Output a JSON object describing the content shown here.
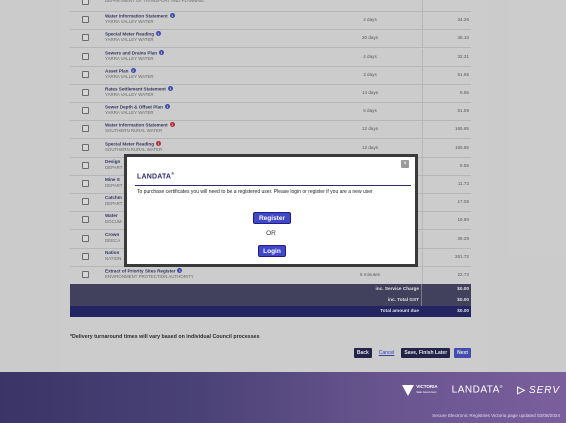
{
  "table": {
    "rows": [
      {
        "name": "",
        "authority": "Department of Transport and Planning",
        "time": "",
        "price": "",
        "info": "none",
        "partial": true
      },
      {
        "name": "Water Information Statement",
        "authority": "YARRA VALLEY WATER",
        "time": "4 days",
        "price": "34.26",
        "info": "blue"
      },
      {
        "name": "Special Meter Reading",
        "authority": "YARRA VALLEY WATER",
        "time": "20 days",
        "price": "46.10",
        "info": "blue"
      },
      {
        "name": "Sewers and Drains Plan",
        "authority": "YARRA VALLEY WATER",
        "time": "4 days",
        "price": "32.31",
        "info": "blue"
      },
      {
        "name": "Asset Plan",
        "authority": "YARRA VALLEY WATER",
        "time": "3 days",
        "price": "51.65",
        "info": "blue"
      },
      {
        "name": "Rates Settlement Statement",
        "authority": "YARRA VALLEY WATER",
        "time": "14 days",
        "price": "8.55",
        "info": "blue"
      },
      {
        "name": "Sewer Depth & Offset Plan",
        "authority": "YARRA VALLEY WATER",
        "time": "5 days",
        "price": "51.59",
        "info": "blue"
      },
      {
        "name": "Water Information Statement",
        "authority": "SOUTHERN RURAL WATER",
        "time": "12 days",
        "price": "165.65",
        "info": "red"
      },
      {
        "name": "Special Meter Reading",
        "authority": "SOUTHERN RURAL WATER",
        "time": "12 days",
        "price": "165.65",
        "info": "red"
      },
      {
        "name": "Design",
        "authority": "Depart",
        "time": "",
        "price": "8.55",
        "info": "none"
      },
      {
        "name": "Mine S",
        "authority": "Depart",
        "time": "",
        "price": "11.72",
        "info": "none"
      },
      {
        "name": "Catchm",
        "authority": "Depart",
        "time": "",
        "price": "17.05",
        "info": "none"
      },
      {
        "name": "Water",
        "authority": "Docum",
        "time": "",
        "price": "16.80",
        "info": "none"
      },
      {
        "name": "Crown",
        "authority": "DEECA",
        "time": "",
        "price": "39.29",
        "info": "none"
      },
      {
        "name": "Nation",
        "authority": "Nation",
        "time": "",
        "price": "261.72",
        "info": "none"
      },
      {
        "name": "Extract of Priority Sites Register",
        "authority": "Environment Protection Authority",
        "time": "5 minutes",
        "price": "22.72",
        "info": "blue"
      }
    ]
  },
  "summary": {
    "service_charge_label": "inc. Service Charge",
    "service_charge_value": "$0.00",
    "gst_label": "inc. Total GST",
    "gst_value": "$0.00",
    "total_label": "Total amount due",
    "total_value": "$0.00"
  },
  "delivery_note": "*Delivery turnaround times will vary based on individual Council processes",
  "actions": {
    "back": "Back",
    "cancel": "Cancel",
    "save_finish": "Save, Finish Later",
    "next": "Next"
  },
  "modal": {
    "brand": "LANDATA",
    "brand_mark": "®",
    "close": "×",
    "message": "To purchase certificates you will need to be a registered user. Please login or register if you are a new user",
    "register": "Register",
    "or": "OR",
    "login": "Login"
  },
  "footer": {
    "vic_line1": "VICTORIA",
    "vic_line2": "State Government",
    "landata": "LANDATA",
    "landata_mark": "®",
    "serv": "SERV",
    "copyright": "Secure Electronic Registries Victoria page updated 02/08/2024"
  },
  "colors": {
    "accent": "#4048c8",
    "summary_bg": "#4a4a6a",
    "total_bg": "#2a2a70",
    "info_red": "#d0343c"
  }
}
